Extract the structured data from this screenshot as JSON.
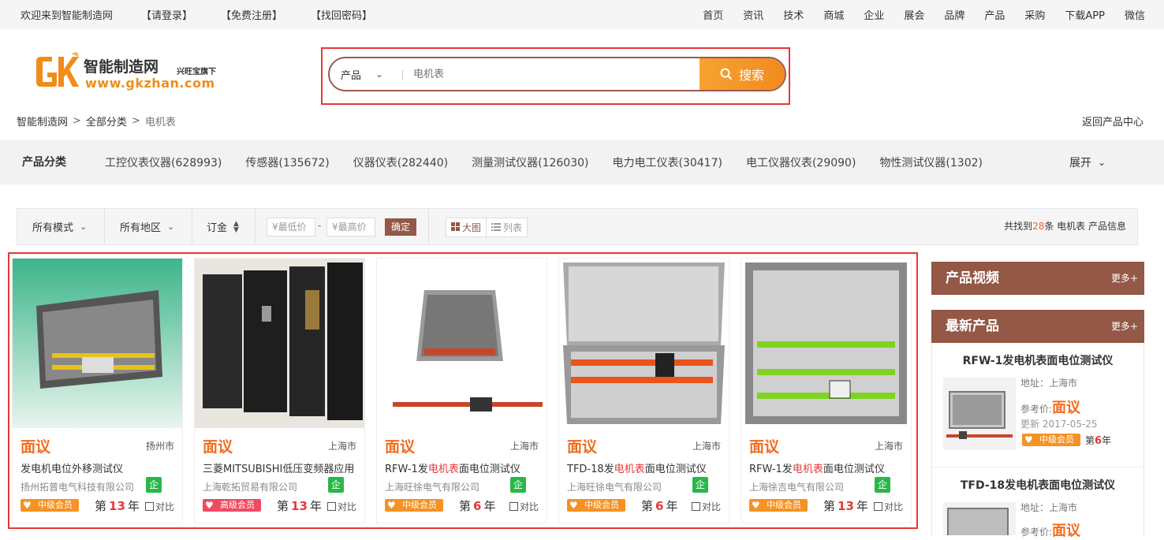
{
  "topbar": {
    "welcome": "欢迎来到智能制造网",
    "login": "【请登录】",
    "register": "【免费注册】",
    "recover": "【找回密码】",
    "nav": [
      "首页",
      "资讯",
      "技术",
      "商城",
      "企业",
      "展会",
      "品牌",
      "产品",
      "采购",
      "下载APP",
      "微信"
    ]
  },
  "logo": {
    "name": "智能制造网",
    "sub": "兴旺宝旗下",
    "url": "www.gkzhan.com",
    "badge_text": "GK"
  },
  "search": {
    "category": "产品",
    "placeholder": "电机表",
    "button": "搜索"
  },
  "breadcrumb": {
    "items": [
      "智能制造网",
      "全部分类",
      "电机表"
    ],
    "separator": ">",
    "back": "返回产品中心"
  },
  "categories": {
    "title": "产品分类",
    "items": [
      "工控仪表仪器(628993)",
      "传感器(135672)",
      "仪器仪表(282440)",
      "测量测试仪器(126030)",
      "电力电工仪表(30417)",
      "电工仪器仪表(29090)",
      "物性测试仪器(1302)"
    ],
    "expand": "展开"
  },
  "filters": {
    "mode": "所有模式",
    "region": "所有地区",
    "deposit": "订金",
    "min_price": "¥最低价",
    "max_price": "¥最高价",
    "dash": "-",
    "confirm": "确定",
    "view_grid": "大图",
    "view_list": "列表",
    "found_prefix": "共找到",
    "found_count": "28",
    "found_suffix": "条 电机表 产品信息"
  },
  "products": [
    {
      "price": "面议",
      "city": "扬州市",
      "name_pre": "发电机电位外移测试仪",
      "name_hl": "",
      "name_post": "",
      "company": "扬州拓普电气科技有限公司",
      "qi": "企",
      "member": "中级会员",
      "member_level": "mid",
      "years_pre": "第",
      "years": "13",
      "years_post": "年",
      "compare": "对比"
    },
    {
      "price": "面议",
      "city": "上海市",
      "name_pre": "三菱MITSUBISHI低压变频器应用",
      "name_hl": "",
      "name_post": "",
      "company": "上海乾拓贸易有限公司",
      "qi": "企",
      "member": "高级会员",
      "member_level": "high",
      "years_pre": "第",
      "years": "13",
      "years_post": "年",
      "compare": "对比"
    },
    {
      "price": "面议",
      "city": "上海市",
      "name_pre": "RFW-1发",
      "name_hl": "电机表",
      "name_post": "面电位测试仪",
      "company": "上海旺徐电气有限公司",
      "qi": "企",
      "member": "中级会员",
      "member_level": "mid",
      "years_pre": "第",
      "years": "6",
      "years_post": "年",
      "compare": "对比"
    },
    {
      "price": "面议",
      "city": "上海市",
      "name_pre": "TFD-18发",
      "name_hl": "电机表",
      "name_post": "面电位测试仪",
      "company": "上海旺徐电气有限公司",
      "qi": "企",
      "member": "中级会员",
      "member_level": "mid",
      "years_pre": "第",
      "years": "6",
      "years_post": "年",
      "compare": "对比"
    },
    {
      "price": "面议",
      "city": "上海市",
      "name_pre": "RFW-1发",
      "name_hl": "电机表",
      "name_post": "面电位测试仪",
      "company": "上海徐吉电气有限公司",
      "qi": "企",
      "member": "中级会员",
      "member_level": "mid",
      "years_pre": "第",
      "years": "13",
      "years_post": "年",
      "compare": "对比"
    }
  ],
  "sidebar": {
    "video_title": "产品视频",
    "video_more": "更多+",
    "latest_title": "最新产品",
    "latest_more": "更多+",
    "items": [
      {
        "title": "RFW-1发电机表面电位测试仪",
        "addr": "地址：上海市",
        "price_label": "参考价:",
        "price": "面议",
        "date": "更新 2017-05-25",
        "member": "中级会员",
        "years_pre": "第",
        "years": "6",
        "years_post": "年"
      },
      {
        "title": "TFD-18发电机表面电位测试仪",
        "addr": "地址：上海市",
        "price_label": "参考价:",
        "price": "面议"
      }
    ]
  },
  "colors": {
    "accent": "#f28a1e",
    "brand": "#935846",
    "highlight": "#e5383b",
    "qi_green": "#2ab74a"
  }
}
